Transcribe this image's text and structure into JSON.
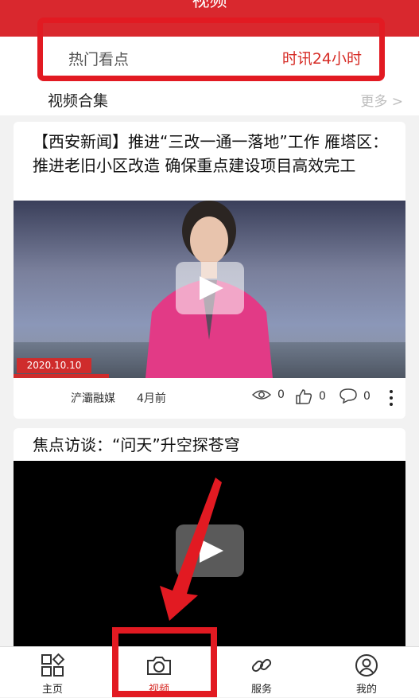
{
  "header": {
    "title": "视频"
  },
  "hot": {
    "left_label": "热门看点",
    "right_label": "时讯24小时"
  },
  "collection": {
    "title": "视频合集",
    "more": "更多 >"
  },
  "videos": [
    {
      "title": "【西安新闻】推进“三改一通一落地”工作 雁塔区：推进老旧小区改造 确保重点建设项目高效完工",
      "thumb_date": "2020.10.10",
      "source": "浐灞融媒",
      "time": "4月前",
      "views": "0",
      "likes": "0",
      "comments": "0"
    },
    {
      "title": "焦点访谈：“问天”升空探苍穹"
    }
  ],
  "tabs": [
    {
      "label": "主页",
      "icon": "apps-icon"
    },
    {
      "label": "视频",
      "icon": "camera-icon",
      "active": true
    },
    {
      "label": "服务",
      "icon": "link-icon"
    },
    {
      "label": "我的",
      "icon": "user-icon"
    }
  ],
  "colors": {
    "header": "#d9282e",
    "accent": "#d62b25",
    "annotation": "#e21a22"
  }
}
